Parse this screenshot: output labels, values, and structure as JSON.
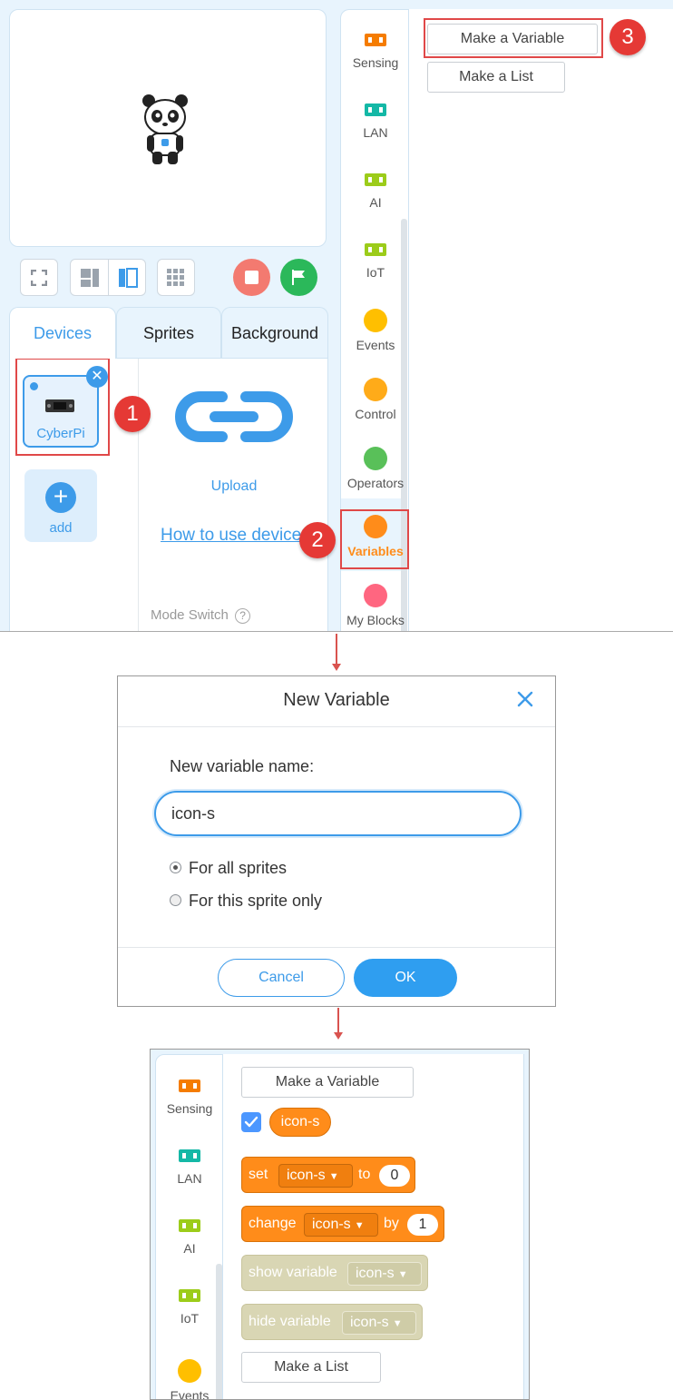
{
  "colors": {
    "accent_blue": "#3d9be9",
    "variables_orange": "#ff8c1a",
    "annotation_red": "#e04848",
    "sensing": "#f57c00",
    "lan": "#14b8a6",
    "ai_iot": "#9ccc1a",
    "events": "#ffbf00",
    "control": "#ffab19",
    "operators": "#59c059",
    "variables": "#ff8c1a",
    "my_blocks": "#ff6680"
  },
  "panel1": {
    "tabs": [
      "Devices",
      "Sprites",
      "Background"
    ],
    "device_card": {
      "label": "CyberPi",
      "icon": "cyberpi-board-icon"
    },
    "add_label": "add",
    "upload_label": "Upload",
    "how_to_link": "How to use device?",
    "mode_switch_label": "Mode Switch",
    "categories": [
      "Sensing",
      "LAN",
      "AI",
      "IoT",
      "Events",
      "Control",
      "Operators",
      "Variables",
      "My Blocks"
    ],
    "make_variable": "Make a Variable",
    "make_list": "Make a List",
    "callouts": [
      "1",
      "2",
      "3"
    ]
  },
  "dialog": {
    "title": "New Variable",
    "field_label": "New variable name:",
    "field_value": "icon-s",
    "option_all": "For all sprites",
    "option_this": "For this sprite only",
    "selected_option": "For all sprites",
    "cancel": "Cancel",
    "ok": "OK"
  },
  "panel3": {
    "categories": [
      "Sensing",
      "LAN",
      "AI",
      "IoT",
      "Events"
    ],
    "make_variable": "Make a Variable",
    "variable_name": "icon-s",
    "variable_checked": true,
    "set_label": "set",
    "to_label": "to",
    "set_value": "0",
    "change_label": "change",
    "by_label": "by",
    "change_value": "1",
    "show_label": "show variable",
    "hide_label": "hide variable",
    "make_list": "Make a List"
  }
}
